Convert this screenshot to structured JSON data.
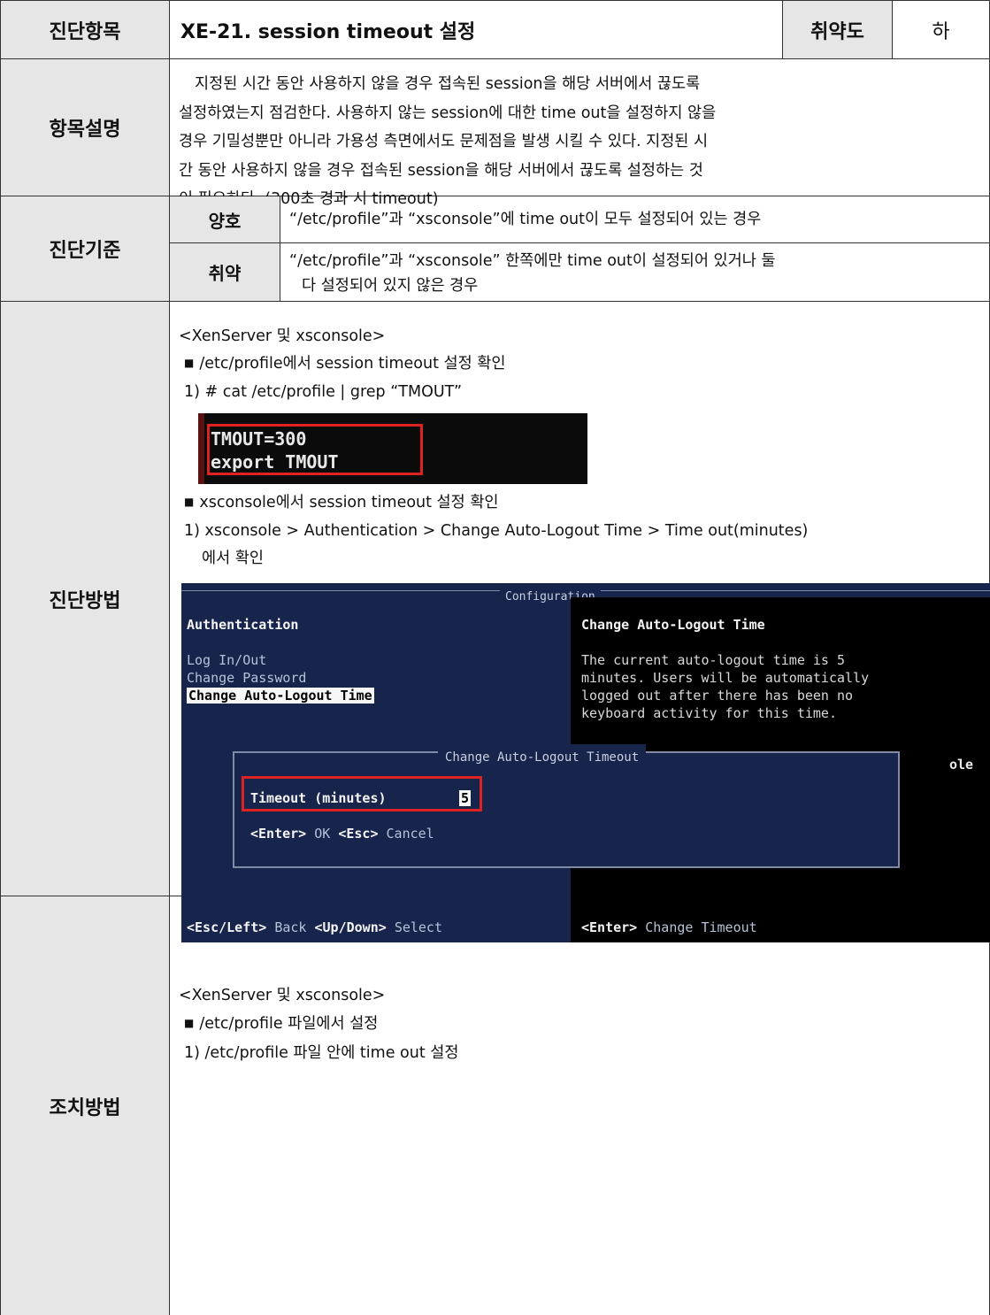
{
  "header": {
    "item_label": "진단항목",
    "title": "XE-21. session timeout 설정",
    "severity_label": "취약도",
    "severity_value": "하"
  },
  "description": {
    "label": "항목설명",
    "lines": [
      "지정된 시간 동안 사용하지 않을 경우 접속된 session을 해당 서버에서 끊도록",
      "설정하였는지 점검한다. 사용하지 않는 session에 대한 time out을 설정하지 않을",
      "경우 기밀성뿐만 아니라 가용성 측면에서도 문제점을 발생 시킬 수 있다. 지정된 시",
      "간 동안 사용하지 않을 경우 접속된 session을 해당 서버에서 끊도록 설정하는 것",
      "이 필요하다. (300초 경과 시 timeout)"
    ]
  },
  "criteria": {
    "label": "진단기준",
    "good_label": "양호",
    "good_text": "“/etc/profile”과 “xsconsole”에 time out이 모두 설정되어 있는 경우",
    "vuln_label": "취약",
    "vuln_line1": "“/etc/profile”과 “xsconsole” 한쪽에만 time out이 설정되어 있거나 둘",
    "vuln_line2": "다 설정되어 있지 않은 경우"
  },
  "method": {
    "label": "진단방법",
    "heading": "<XenServer 및 xsconsole>",
    "bullet1": "/etc/profile에서 session timeout 설정 확인",
    "step1": "1) # cat /etc/profile | grep “TMOUT”",
    "terminal": {
      "line1": "TMOUT=300",
      "line2": "export  TMOUT"
    },
    "bullet2": "xsconsole에서 session timeout 설정 확인",
    "step2_line1": "1) xsconsole > Authentication > Change Auto-Logout Time > Time out(minutes)",
    "step2_line2": "에서 확인",
    "console": {
      "top_title": "Configuration",
      "left_heading": "Authentication",
      "menu1": "Log In/Out",
      "menu2": "Change Password",
      "menu3": "Change Auto-Logout Time",
      "right_heading": "Change Auto-Logout Time",
      "right_line1": "The current auto-logout time is 5",
      "right_line2": "minutes.  Users will be automatically",
      "right_line3": "logged out after there has been no",
      "right_line4": "keyboard activity for this time.",
      "right_tail": "ole",
      "dialog_title": "Change Auto-Logout Timeout",
      "timeout_label": "Timeout (minutes)",
      "timeout_value": "5",
      "enter_key": "<Enter>",
      "ok_text": "OK",
      "esc_key": "<Esc>",
      "cancel_text": "Cancel",
      "footer_left_key1": "<Esc/Left>",
      "footer_left_text1": "Back",
      "footer_left_key2": "<Up/Down>",
      "footer_left_text2": "Select",
      "footer_right_key": "<Enter>",
      "footer_right_text": "Change Timeout"
    }
  },
  "fix": {
    "label": "조치방법",
    "heading": "<XenServer 및 xsconsole>",
    "bullet1": "/etc/profile 파일에서 설정",
    "step1": "1) /etc/profile 파일 안에 time out 설정"
  }
}
